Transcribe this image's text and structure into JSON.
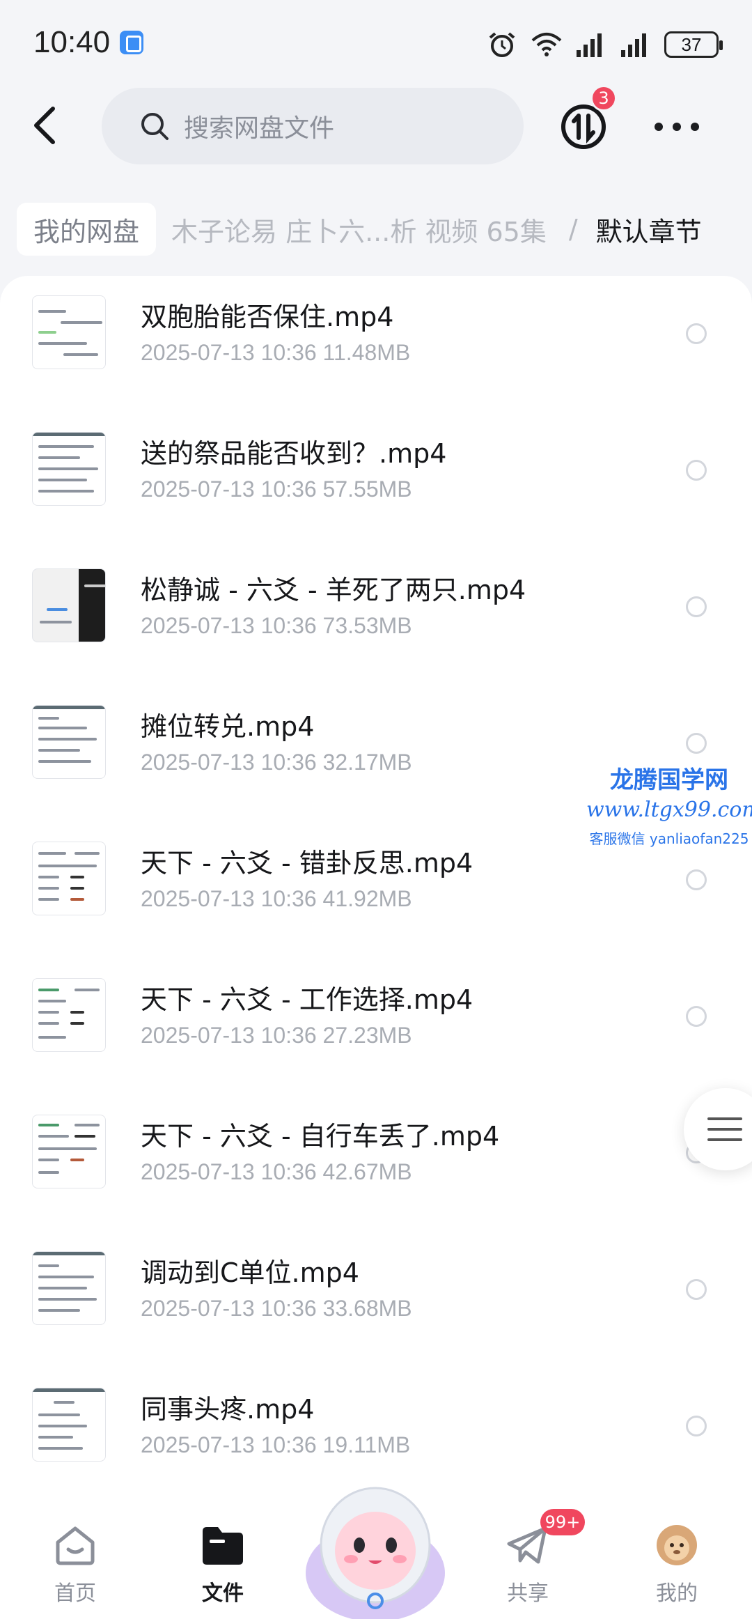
{
  "status_bar": {
    "time": "10:40",
    "battery": "37"
  },
  "search": {
    "placeholder": "搜索网盘文件"
  },
  "transfer_badge": "3",
  "breadcrumb": {
    "root": "我的网盘",
    "middle": "木子论易 庄卜六...析 视频 65集",
    "separator": "/",
    "current": "默认章节"
  },
  "files": [
    {
      "name": "双胞胎能否保住.mp4",
      "meta": "2025-07-13  10:36   11.48MB"
    },
    {
      "name": "送的祭品能否收到？.mp4",
      "meta": "2025-07-13  10:36   57.55MB"
    },
    {
      "name": "松静诚 - 六爻 - 羊死了两只.mp4",
      "meta": "2025-07-13  10:36   73.53MB"
    },
    {
      "name": "摊位转兑.mp4",
      "meta": "2025-07-13  10:36   32.17MB"
    },
    {
      "name": "天下 - 六爻 - 错卦反思.mp4",
      "meta": "2025-07-13  10:36   41.92MB"
    },
    {
      "name": "天下 - 六爻 - 工作选择.mp4",
      "meta": "2025-07-13  10:36   27.23MB"
    },
    {
      "name": "天下 - 六爻 - 自行车丢了.mp4",
      "meta": "2025-07-13  10:36   42.67MB"
    },
    {
      "name": "调动到C单位.mp4",
      "meta": "2025-07-13  10:36   33.68MB"
    },
    {
      "name": "同事头疼.mp4",
      "meta": "2025-07-13  10:36   19.11MB"
    }
  ],
  "watermark": {
    "title": "龙腾国学网",
    "url": "www.ltgx99.com",
    "wechat": "客服微信 yanliaofan225"
  },
  "nav": {
    "home": "首页",
    "files": "文件",
    "share": "共享",
    "share_badge": "99+",
    "mine": "我的"
  },
  "colors": {
    "accent_red": "#f0475e",
    "watermark_blue": "#2a74e8"
  }
}
